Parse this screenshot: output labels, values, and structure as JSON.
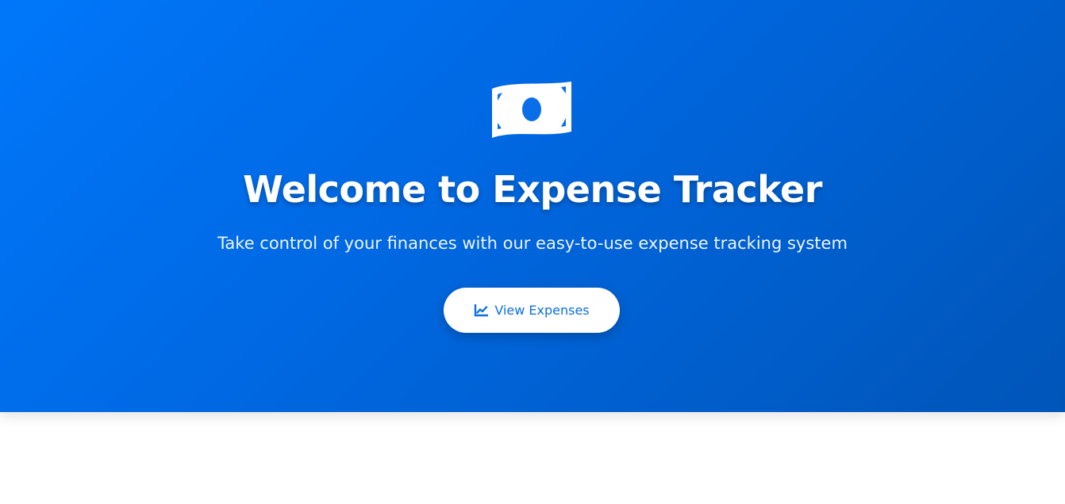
{
  "hero": {
    "icon": "money-bill-icon",
    "title": "Welcome to Expense Tracker",
    "subtitle": "Take control of your finances with our easy-to-use expense tracking system",
    "cta": {
      "label": "View Expenses",
      "icon": "chart-line-icon"
    }
  },
  "colors": {
    "hero_gradient_start": "#0077fa",
    "hero_gradient_end": "#0055b8",
    "accent": "#0b6fe6",
    "text_on_accent": "#ffffff"
  }
}
